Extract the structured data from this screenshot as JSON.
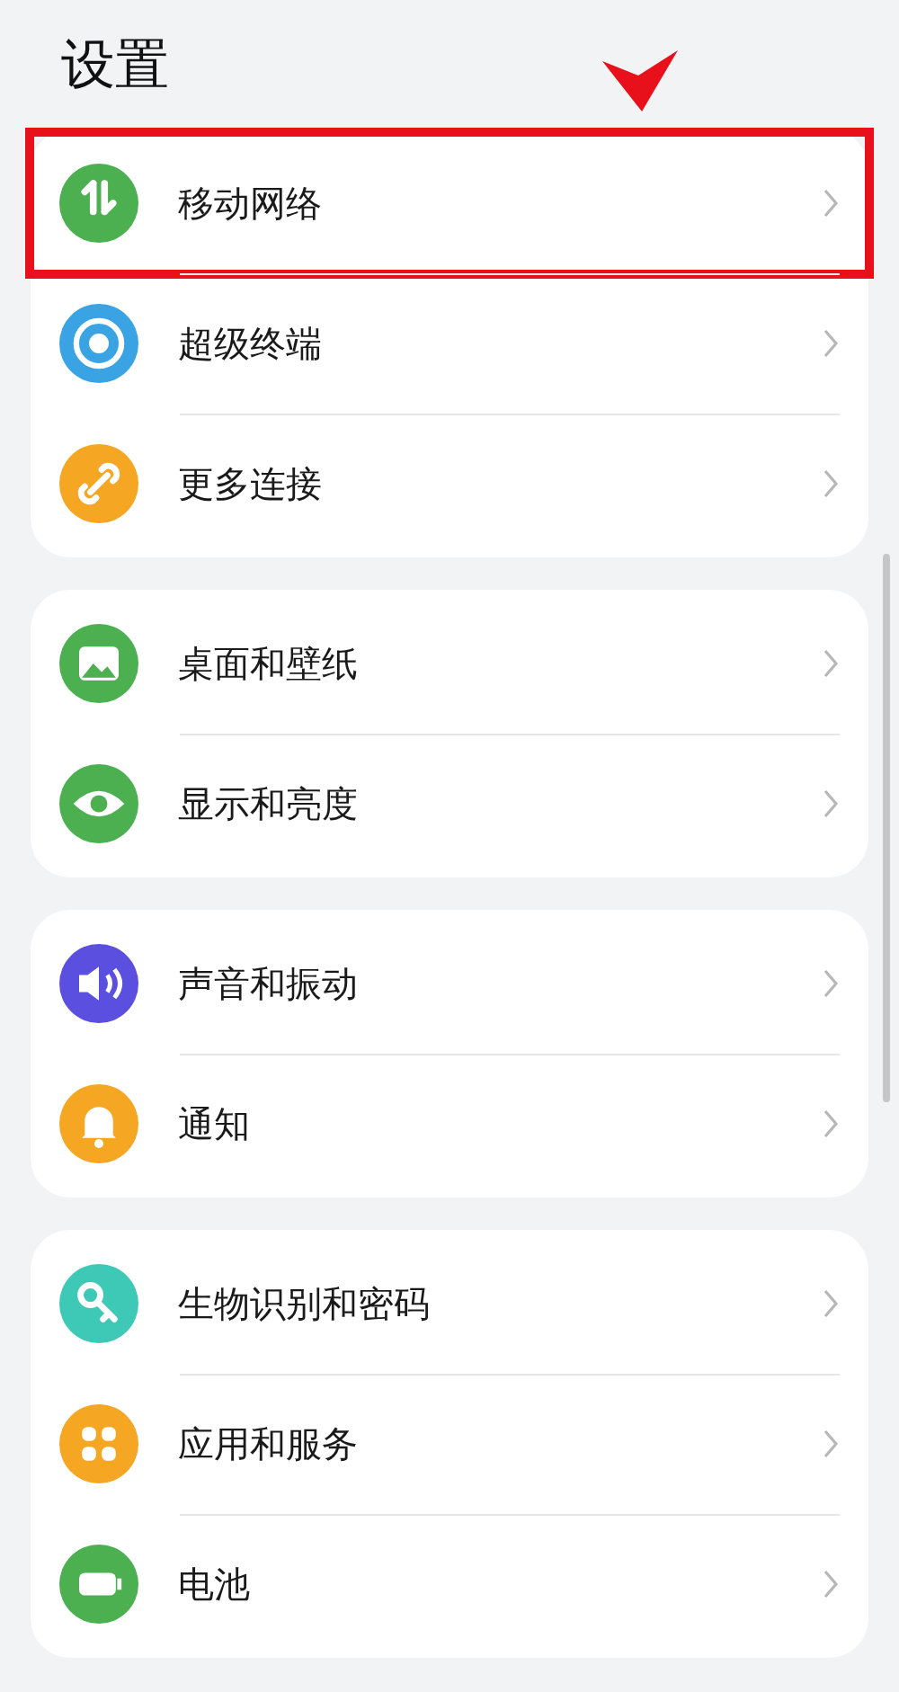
{
  "title": "设置",
  "groups": [
    {
      "items": [
        {
          "label": "移动网络",
          "color": "#4cb050",
          "highlighted": true
        },
        {
          "label": "超级终端",
          "color": "#3aa3e3",
          "highlighted": false
        },
        {
          "label": "更多连接",
          "color": "#f5a623",
          "highlighted": false
        }
      ]
    },
    {
      "items": [
        {
          "label": "桌面和壁纸",
          "color": "#4cb050",
          "highlighted": false
        },
        {
          "label": "显示和亮度",
          "color": "#4cb050",
          "highlighted": false
        }
      ]
    },
    {
      "items": [
        {
          "label": "声音和振动",
          "color": "#5b4fe0",
          "highlighted": false
        },
        {
          "label": "通知",
          "color": "#f5a623",
          "highlighted": false
        }
      ]
    },
    {
      "items": [
        {
          "label": "生物识别和密码",
          "color": "#3ec9b6",
          "highlighted": false
        },
        {
          "label": "应用和服务",
          "color": "#f5a623",
          "highlighted": false
        },
        {
          "label": "电池",
          "color": "#4cb050",
          "highlighted": false
        }
      ]
    }
  ]
}
